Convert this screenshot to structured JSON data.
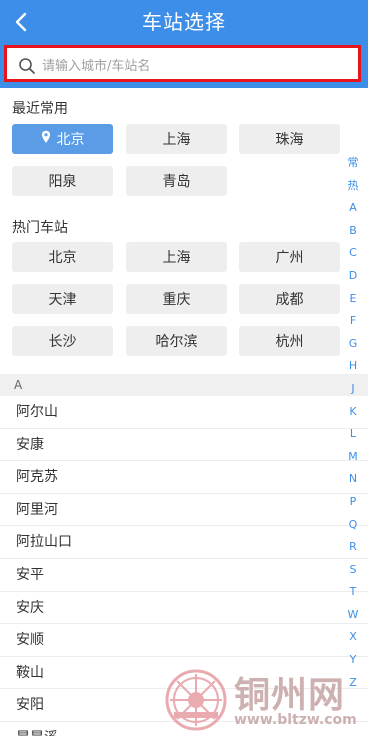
{
  "header": {
    "title": "车站选择",
    "back_icon": "chevron-left-icon"
  },
  "search": {
    "placeholder": "请输入城市/车站名",
    "value": "",
    "icon": "search-icon",
    "highlight_color": "#e8141c"
  },
  "recent": {
    "title": "最近常用",
    "items": [
      {
        "label": "北京",
        "selected": true,
        "icon": "location-pin-icon"
      },
      {
        "label": "上海"
      },
      {
        "label": "珠海"
      },
      {
        "label": "阳泉"
      },
      {
        "label": "青岛"
      }
    ]
  },
  "hot": {
    "title": "热门车站",
    "items": [
      {
        "label": "北京"
      },
      {
        "label": "上海"
      },
      {
        "label": "广州"
      },
      {
        "label": "天津"
      },
      {
        "label": "重庆"
      },
      {
        "label": "成都"
      },
      {
        "label": "长沙"
      },
      {
        "label": "哈尔滨"
      },
      {
        "label": "杭州"
      }
    ]
  },
  "index_bar": [
    "常",
    "热",
    "A",
    "B",
    "C",
    "D",
    "E",
    "F",
    "G",
    "H",
    "J",
    "K",
    "L",
    "M",
    "N",
    "P",
    "Q",
    "R",
    "S",
    "T",
    "W",
    "X",
    "Y",
    "Z"
  ],
  "group": {
    "letter": "A",
    "stations": [
      "阿尔山",
      "安康",
      "阿克苏",
      "阿里河",
      "阿拉山口",
      "安平",
      "安庆",
      "安顺",
      "鞍山",
      "安阳",
      "昂昂溪"
    ]
  },
  "watermark": {
    "name": "铜州网",
    "url": "www.bltzw.com"
  },
  "colors": {
    "header": "#3d8ee8",
    "selected_chip": "#5b9ce6",
    "chip": "#eeeeee",
    "index_letter": "#3d8ee8"
  }
}
